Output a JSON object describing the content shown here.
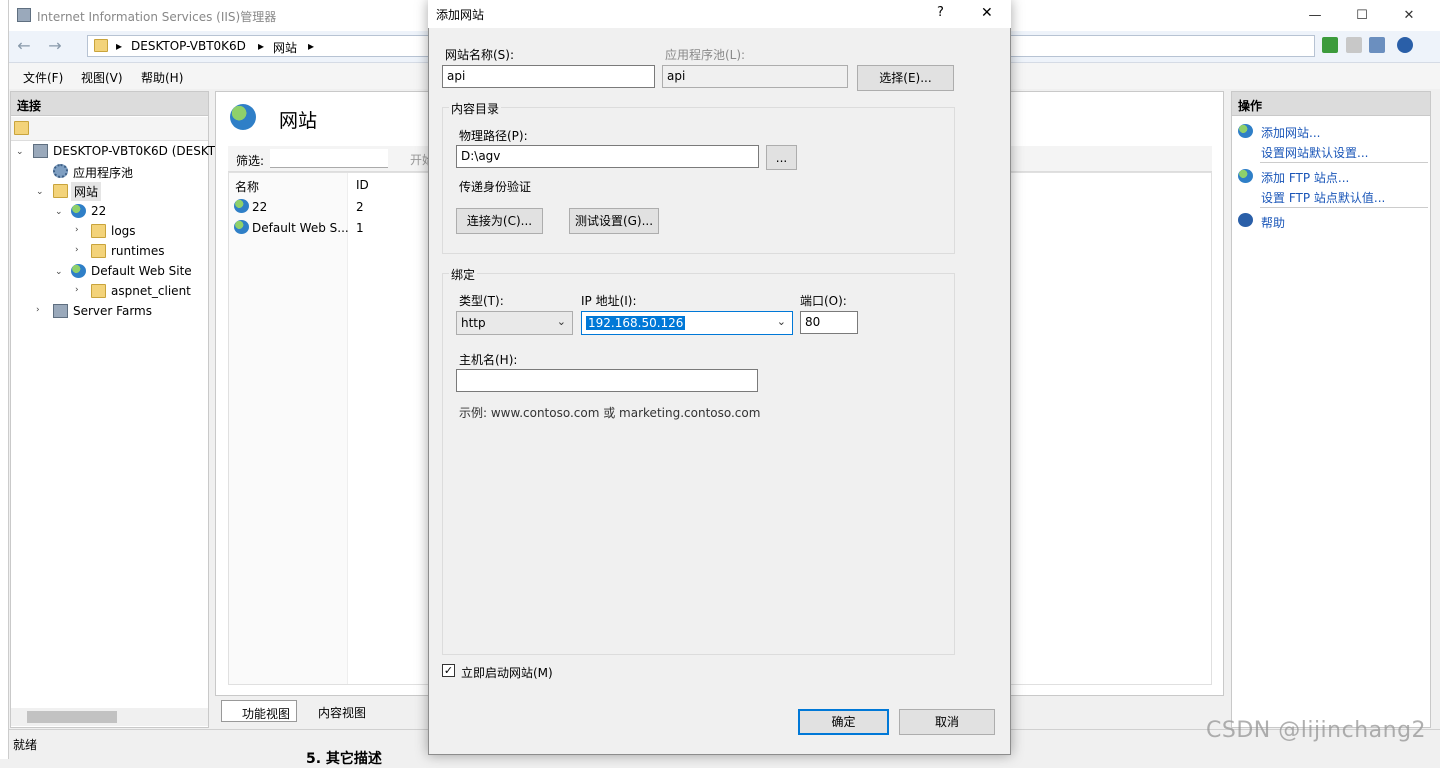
{
  "window": {
    "title": "Internet Information Services (IIS)管理器",
    "minimize_glyph": "—",
    "maximize_glyph": "☐",
    "close_glyph": "✕"
  },
  "address": {
    "back_glyph": "←",
    "forward_glyph": "→",
    "crumbs": [
      "DESKTOP-VBT0K6D",
      "网站"
    ],
    "sep": "▸"
  },
  "menu": [
    "文件(F)",
    "视图(V)",
    "帮助(H)"
  ],
  "connections": {
    "title": "连接",
    "tree": {
      "server": "DESKTOP-VBT0K6D (DESKT",
      "app_pools": "应用程序池",
      "sites": "网站",
      "site_22": "22",
      "logs": "logs",
      "runtimes": "runtimes",
      "default_site": "Default Web Site",
      "aspnet_client": "aspnet_client",
      "server_farms": "Server Farms"
    }
  },
  "main": {
    "title": "网站",
    "filter_label": "筛选:",
    "filter_go": "开始",
    "col_name": "名称",
    "col_id": "ID",
    "rows": [
      {
        "name": "22",
        "id": "2"
      },
      {
        "name": "Default Web S...",
        "id": "1"
      }
    ],
    "tab_features": "功能视图",
    "tab_content": "内容视图"
  },
  "actions": {
    "title": "操作",
    "add_site": "添加网站...",
    "site_defaults": "设置网站默认设置...",
    "add_ftp": "添加 FTP 站点...",
    "ftp_defaults": "设置 FTP 站点默认值...",
    "help": "帮助"
  },
  "status": {
    "text": "就绪"
  },
  "dialog": {
    "title": "添加网站",
    "help_glyph": "?",
    "close_glyph": "✕",
    "site_name_label": "网站名称(S):",
    "site_name_value": "api",
    "app_pool_label": "应用程序池(L):",
    "app_pool_value": "api",
    "select_button": "选择(E)...",
    "content_group": "内容目录",
    "physical_path_label": "物理路径(P):",
    "physical_path_value": "D:\\agv",
    "browse_button": "...",
    "pass_auth_label": "传递身份验证",
    "connect_as_button": "连接为(C)...",
    "test_settings_button": "测试设置(G)...",
    "binding_group": "绑定",
    "type_label": "类型(T):",
    "type_value": "http",
    "ip_label": "IP 地址(I):",
    "ip_value": "192.168.50.126",
    "port_label": "端口(O):",
    "port_value": "80",
    "host_label": "主机名(H):",
    "host_value": "",
    "example_text": "示例: www.contoso.com 或 marketing.contoso.com",
    "start_now_label": "立即启动网站(M)",
    "start_now_checked": true,
    "ok_button": "确定",
    "cancel_button": "取消"
  },
  "background_heading": "5. 其它描述",
  "watermark": "CSDN @lijinchang2"
}
